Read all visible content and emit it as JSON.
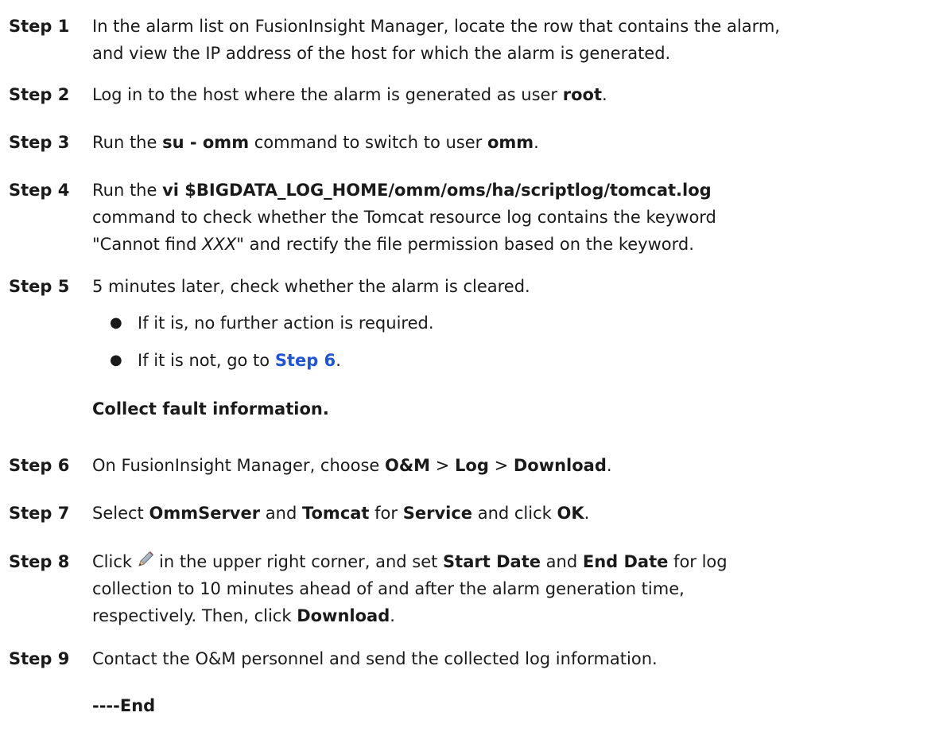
{
  "steps": [
    {
      "label": "Step 1",
      "line1": "In the alarm list on FusionInsight Manager, locate the row that contains the alarm,",
      "line2": "and view the IP address of the host for which the alarm is generated."
    },
    {
      "label": "Step 2",
      "pre": "Log in to the host where the alarm is generated as user ",
      "user": "root",
      "post": "."
    },
    {
      "label": "Step 3",
      "pre": "Run the ",
      "cmd": "su - omm",
      "mid": " command to switch to user ",
      "user": "omm",
      "post": "."
    },
    {
      "label": "Step 4",
      "pre": "Run the ",
      "cmd": "vi $BIGDATA_LOG_HOME/omm/oms/ha/scriptlog/tomcat.log",
      "line2": "command to check whether the Tomcat resource log contains the keyword",
      "line3_pre": "\"Cannot find ",
      "line3_var": "XXX",
      "line3_post": "\" and rectify the file permission based on the keyword."
    },
    {
      "label": "Step 5",
      "text": "5 minutes later, check whether the alarm is cleared.",
      "bullet1": "If it is, no further action is required.",
      "bullet2_pre": "If it is not, go to ",
      "bullet2_link": "Step 6",
      "bullet2_post": "."
    },
    {
      "label": "Step 6",
      "pre": "On FusionInsight Manager, choose ",
      "m1": "O&M",
      "sep1": " > ",
      "m2": "Log",
      "sep2": " > ",
      "m3": "Download",
      "post": "."
    },
    {
      "label": "Step 7",
      "t1": "Select ",
      "b1": "OmmServer",
      "t2": " and ",
      "b2": "Tomcat",
      "t3": " for ",
      "b3": "Service",
      "t4": " and click ",
      "b4": "OK",
      "t5": "."
    },
    {
      "label": "Step 8",
      "t1": "Click",
      "t2": "in the upper right corner, and set ",
      "b1": "Start Date",
      "t3": " and ",
      "b2": "End Date",
      "t4": " for log",
      "line2": "collection to 10 minutes ahead of and after the alarm generation time,",
      "line3_pre": "respectively. Then, click ",
      "line3_b": "Download",
      "line3_post": "."
    },
    {
      "label": "Step 9",
      "text": "Contact the O&M personnel and send the collected log information."
    }
  ],
  "section_heading": "Collect fault information.",
  "end_mark": "----End",
  "icons": {
    "edit": "pencil-icon"
  },
  "colors": {
    "link": "#1f56d6",
    "text": "#1a1a1a"
  }
}
